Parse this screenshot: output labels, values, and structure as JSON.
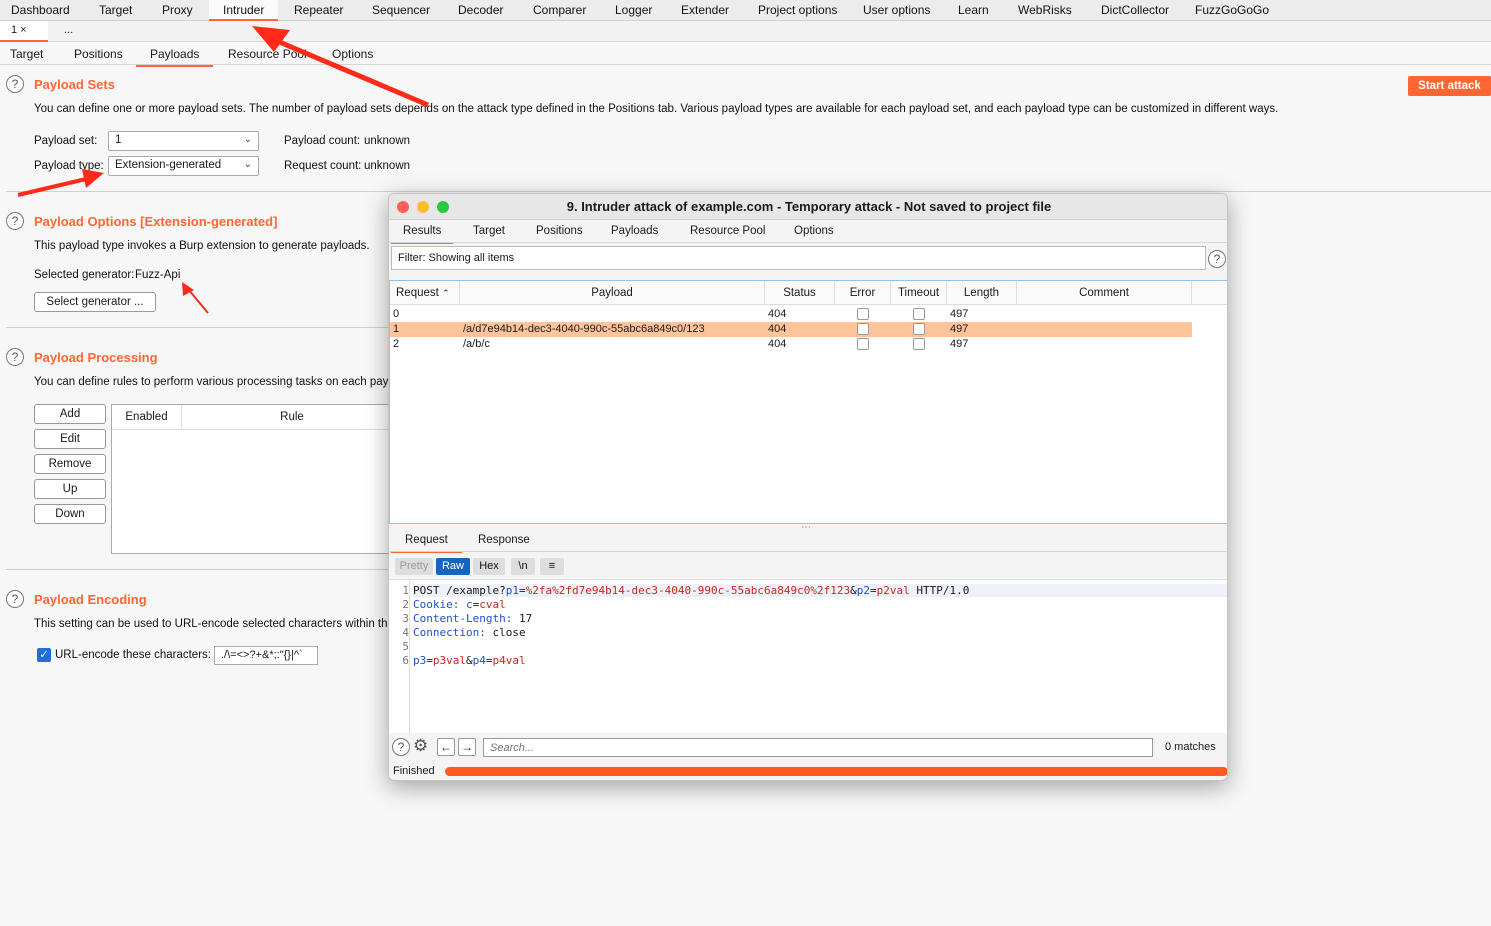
{
  "top_tabs": [
    "Dashboard",
    "Target",
    "Proxy",
    "Intruder",
    "Repeater",
    "Sequencer",
    "Decoder",
    "Comparer",
    "Logger",
    "Extender",
    "Project options",
    "User options",
    "Learn",
    "WebRisks",
    "DictCollector",
    "FuzzGoGoGo"
  ],
  "active_top_tab": "Intruder",
  "attack_tabs": {
    "first": "1 ×",
    "more": "..."
  },
  "intruder_tabs": [
    "Target",
    "Positions",
    "Payloads",
    "Resource Pool",
    "Options"
  ],
  "start_attack": "Start attack",
  "payload_sets": {
    "title": "Payload Sets",
    "desc": "You can define one or more payload sets. The number of payload sets depends on the attack type defined in the Positions tab. Various payload types are available for each payload set, and each payload type can be customized in different ways.",
    "set_label": "Payload set:",
    "set_value": "1",
    "type_label": "Payload type:",
    "type_value": "Extension-generated",
    "count_label": "Payload count:",
    "count_value": "unknown",
    "req_label": "Request count:",
    "req_value": "unknown"
  },
  "payload_options": {
    "title": "Payload Options [Extension-generated]",
    "desc": "This payload type invokes a Burp extension to generate payloads.",
    "gen_label": "Selected generator:",
    "gen_value": "Fuzz-Api",
    "select_btn": "Select generator ..."
  },
  "payload_processing": {
    "title": "Payload Processing",
    "desc": "You can define rules to perform various processing tasks on each payload",
    "buttons": [
      "Add",
      "Edit",
      "Remove",
      "Up",
      "Down"
    ],
    "col_enabled": "Enabled",
    "col_rule": "Rule"
  },
  "payload_encoding": {
    "title": "Payload Encoding",
    "desc": "This setting can be used to URL-encode selected characters within the f",
    "checkbox_label": "URL-encode these characters:",
    "chars": "./\\=<>?+&*;:\"{}|^`"
  },
  "attack_window": {
    "title": "9. Intruder attack of example.com - Temporary attack - Not saved to project file",
    "tabs": [
      "Results",
      "Target",
      "Positions",
      "Payloads",
      "Resource Pool",
      "Options"
    ],
    "filter": "Filter: Showing all items",
    "columns": [
      "Request",
      "Payload",
      "Status",
      "Error",
      "Timeout",
      "Length",
      "Comment"
    ],
    "rows": [
      {
        "request": "0",
        "payload": "",
        "status": "404",
        "length": "497"
      },
      {
        "request": "1",
        "payload": "/a/d7e94b14-dec3-4040-990c-55abc6a849c0/123",
        "status": "404",
        "length": "497"
      },
      {
        "request": "2",
        "payload": "/a/b/c",
        "status": "404",
        "length": "497"
      }
    ],
    "selected_row": 1,
    "req_tabs": [
      "Request",
      "Response"
    ],
    "format_buttons": [
      "Pretty",
      "Raw",
      "Hex",
      "\\n",
      "≡"
    ],
    "code_lines": [
      {
        "n": "1",
        "parts": [
          [
            "",
            "POST /example?"
          ],
          [
            "kw",
            "p1"
          ],
          [
            "",
            "="
          ],
          [
            "val",
            "%2fa%2fd7e94b14-dec3-4040-990c-55abc6a849c0%2f123"
          ],
          [
            "",
            "&"
          ],
          [
            "kw",
            "p2"
          ],
          [
            "",
            "="
          ],
          [
            "val",
            "p2val"
          ],
          [
            "",
            " HTTP/1.0"
          ]
        ]
      },
      {
        "n": "2",
        "parts": [
          [
            "kw",
            "Cookie:"
          ],
          [
            "",
            " "
          ],
          [
            "kw",
            "c"
          ],
          [
            "",
            "="
          ],
          [
            "val",
            "cval"
          ]
        ]
      },
      {
        "n": "3",
        "parts": [
          [
            "kw",
            "Content-Length:"
          ],
          [
            "",
            " 17"
          ]
        ]
      },
      {
        "n": "4",
        "parts": [
          [
            "kw",
            "Connection:"
          ],
          [
            "",
            " close"
          ]
        ]
      },
      {
        "n": "5",
        "parts": []
      },
      {
        "n": "6",
        "parts": [
          [
            "kw",
            "p3"
          ],
          [
            "",
            "="
          ],
          [
            "val",
            "p3val"
          ],
          [
            "",
            "&"
          ],
          [
            "kw",
            "p4"
          ],
          [
            "",
            "="
          ],
          [
            "val",
            "p4val"
          ]
        ]
      }
    ],
    "search_placeholder": "Search...",
    "matches": "0 matches",
    "status": "Finished",
    "progress": 1.0
  },
  "colors": {
    "accent": "#ff6633",
    "selected_row": "#ffc49a",
    "annotation_arrow": "#ff2a1a"
  }
}
